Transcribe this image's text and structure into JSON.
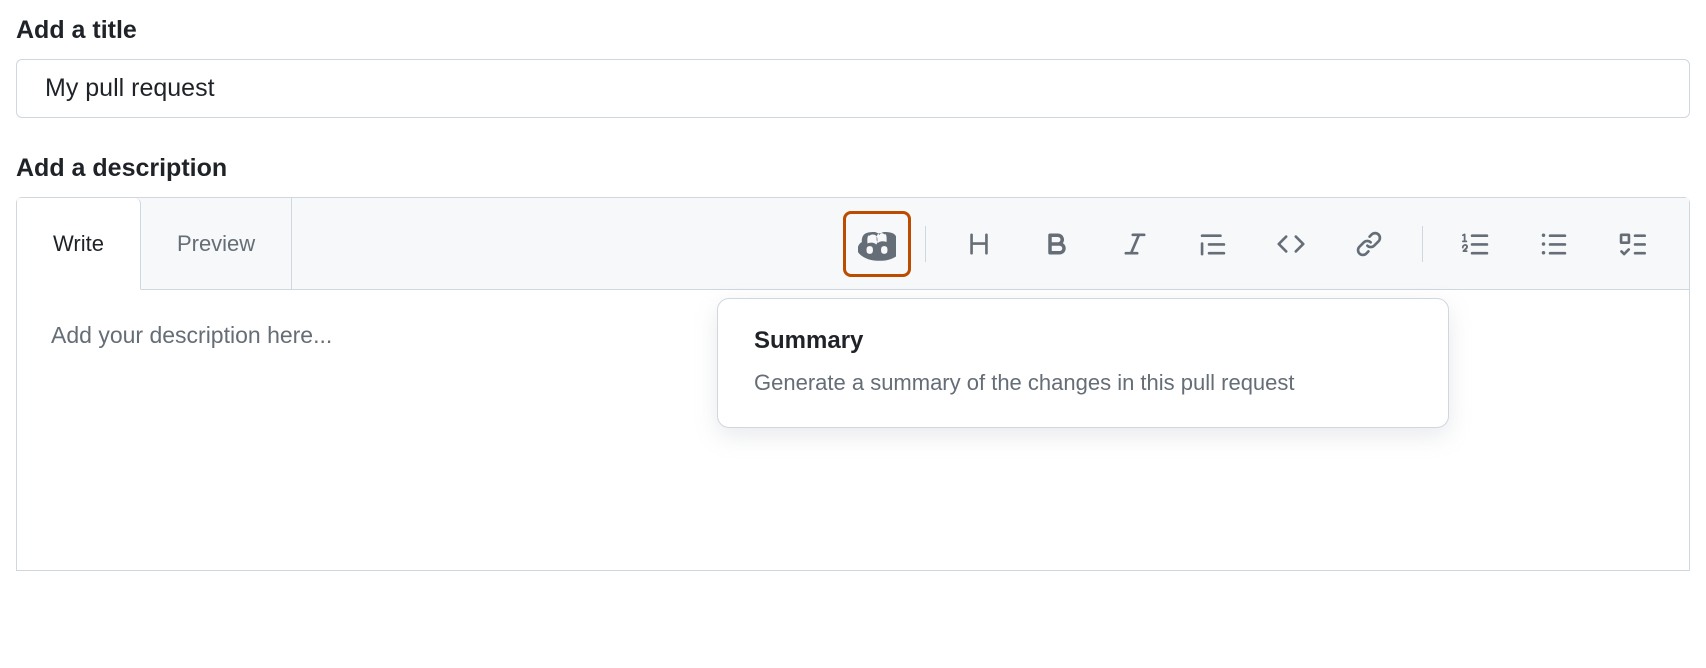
{
  "title_section": {
    "heading": "Add a title",
    "value": "My pull request"
  },
  "description_section": {
    "heading": "Add a description",
    "tabs": {
      "write": "Write",
      "preview": "Preview"
    },
    "placeholder": "Add your description here..."
  },
  "toolbar": {
    "copilot": "copilot",
    "heading": "heading",
    "bold": "bold",
    "italic": "italic",
    "quote": "quote",
    "code": "code",
    "link": "link",
    "ordered_list": "ordered-list",
    "unordered_list": "unordered-list",
    "task_list": "task-list"
  },
  "dropdown": {
    "title": "Summary",
    "description": "Generate a summary of the changes in this pull request"
  },
  "colors": {
    "highlight": "#bc4c00",
    "border": "#d0d7de",
    "muted": "#656d76",
    "bg_subtle": "#f6f8fa"
  }
}
